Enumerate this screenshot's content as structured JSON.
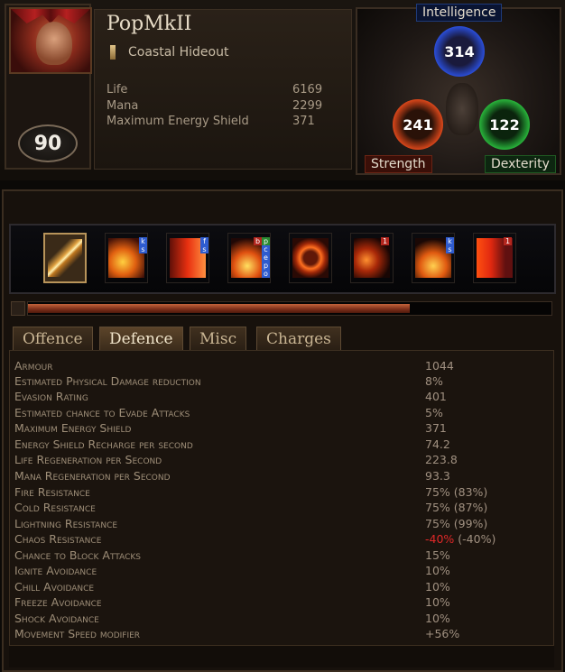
{
  "character": {
    "name": "PopMkII",
    "location": "Coastal Hideout",
    "level": "90",
    "stats": [
      {
        "label": "Life",
        "value": "6169"
      },
      {
        "label": "Mana",
        "value": "2299"
      },
      {
        "label": "Maximum Energy Shield",
        "value": "371"
      }
    ]
  },
  "attributes": {
    "intelligence": {
      "label": "Intelligence",
      "value": "314",
      "color": "#2a4dd6"
    },
    "strength": {
      "label": "Strength",
      "value": "241",
      "color": "#d8461a"
    },
    "dexterity": {
      "label": "Dexterity",
      "value": "122",
      "color": "#28b13a"
    }
  },
  "skills": [
    {
      "icon": "sword-icon",
      "supports": []
    },
    {
      "icon": "fire-swirl-icon",
      "supports": [
        {
          "t": "k",
          "c": "b"
        },
        {
          "t": "s",
          "c": "b"
        }
      ]
    },
    {
      "icon": "running-figure-icon",
      "supports": [
        {
          "t": "f",
          "c": "b"
        },
        {
          "t": "s",
          "c": "b"
        }
      ]
    },
    {
      "icon": "explosion-icon",
      "supports": [
        {
          "t": "b",
          "c": "r"
        },
        {
          "t": "p",
          "c": "g"
        },
        {
          "t": "c",
          "c": "b"
        },
        {
          "t": "e",
          "c": "b"
        },
        {
          "t": "p",
          "c": "b"
        },
        {
          "t": "o",
          "c": "b"
        }
      ]
    },
    {
      "icon": "flame-ring-icon",
      "supports": []
    },
    {
      "icon": "fire-trail-icon",
      "supports": [
        {
          "t": "1",
          "c": "r"
        }
      ]
    },
    {
      "icon": "burst-icon",
      "supports": [
        {
          "t": "k",
          "c": "b"
        },
        {
          "t": "s",
          "c": "b"
        }
      ]
    },
    {
      "icon": "flaming-face-icon",
      "supports": [
        {
          "t": "1",
          "c": "r"
        }
      ]
    }
  ],
  "experience_progress": 0.73,
  "tabs": [
    "Offence",
    "Defence",
    "Misc",
    "Charges"
  ],
  "active_tab": "Defence",
  "defence_stats": [
    {
      "label": "Armour",
      "value": "1044"
    },
    {
      "label": "Estimated Physical Damage reduction",
      "value": "8%"
    },
    {
      "label": "Evasion Rating",
      "value": "401"
    },
    {
      "label": "Estimated chance to Evade Attacks",
      "value": "5%"
    },
    {
      "label": "Maximum Energy Shield",
      "value": "371"
    },
    {
      "label": "Energy Shield Recharge per second",
      "value": "74.2"
    },
    {
      "label": "Life Regeneration per Second",
      "value": "223.8"
    },
    {
      "label": "Mana Regeneration per Second",
      "value": "93.3"
    },
    {
      "label": "Fire Resistance",
      "value": "75% (83%)"
    },
    {
      "label": "Cold Resistance",
      "value": "75% (87%)"
    },
    {
      "label": "Lightning Resistance",
      "value": "75% (99%)"
    },
    {
      "label": "Chaos Resistance",
      "value_red": "-40%",
      "value": " (-40%)"
    },
    {
      "label": "Chance to Block Attacks",
      "value": "15%"
    },
    {
      "label": "Ignite Avoidance",
      "value": "10%"
    },
    {
      "label": "Chill Avoidance",
      "value": "10%"
    },
    {
      "label": "Freeze Avoidance",
      "value": "10%"
    },
    {
      "label": "Shock Avoidance",
      "value": "10%"
    },
    {
      "label": "Movement Speed modifier",
      "value": "+56%"
    }
  ]
}
